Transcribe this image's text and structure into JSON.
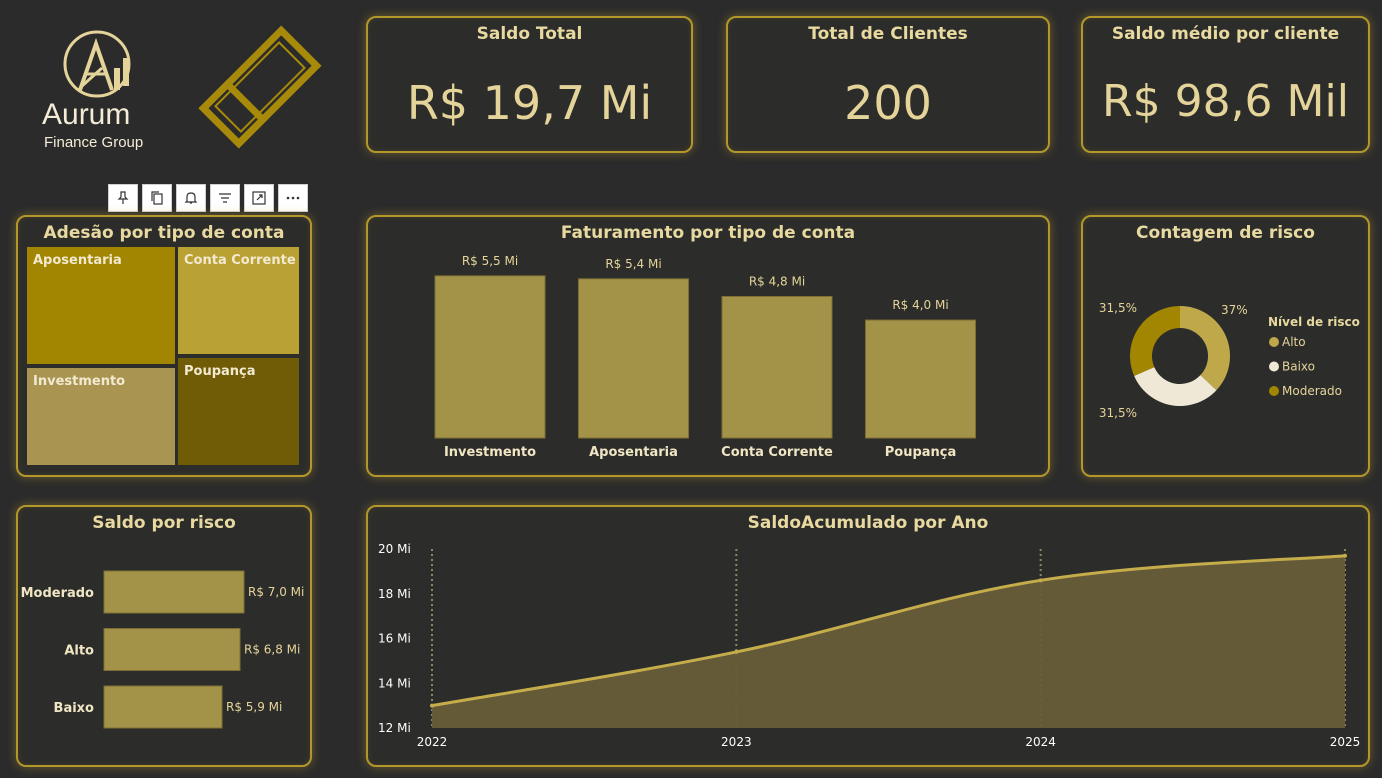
{
  "brand": {
    "name": "Aurum",
    "subtitle": "Finance Group"
  },
  "colors": {
    "background": "#2b2b2b",
    "accent": "#b3972a",
    "text": "#e8d9a0",
    "bar": "#a39348",
    "treemap": [
      "#a28500",
      "#baa133",
      "#a99551",
      "#705c06"
    ],
    "donut": {
      "Alto": "#bfa84a",
      "Baixo": "#efe8d6",
      "Moderado": "#a28500"
    },
    "area_fill": "#675d38",
    "area_line": "#c4ad4a"
  },
  "toolbar": {
    "icons": [
      "pin-icon",
      "copy-icon",
      "bell-icon",
      "filter-icon",
      "expand-icon",
      "more-icon"
    ]
  },
  "kpis": {
    "saldo_total": {
      "title": "Saldo Total",
      "value": "R$ 19,7 Mi"
    },
    "total_clientes": {
      "title": "Total de Clientes",
      "value": "200"
    },
    "saldo_medio": {
      "title": "Saldo médio por cliente",
      "value": "R$ 98,6 Mil"
    }
  },
  "treemap": {
    "title": "Adesão por tipo de conta",
    "items": [
      {
        "label": "Aposentaria"
      },
      {
        "label": "Conta Corrente"
      },
      {
        "label": "Investmento"
      },
      {
        "label": "Poupança"
      }
    ]
  },
  "faturamento": {
    "title": "Faturamento por tipo de conta"
  },
  "risco": {
    "title": "Contagem de risco",
    "legend_title": "Nível de risco"
  },
  "saldo_risco": {
    "title": "Saldo por risco"
  },
  "saldo_ano": {
    "title": "SaldoAcumulado por Ano"
  },
  "chart_data": [
    {
      "id": "faturamento",
      "type": "bar",
      "title": "Faturamento por tipo de conta",
      "categories": [
        "Investmento",
        "Aposentaria",
        "Conta Corrente",
        "Poupança"
      ],
      "values": [
        5.5,
        5.4,
        4.8,
        4.0
      ],
      "labels": [
        "R$ 5,5 Mi",
        "R$ 5,4 Mi",
        "R$ 4,8 Mi",
        "R$ 4,0 Mi"
      ],
      "ylim": [
        0,
        5.8
      ]
    },
    {
      "id": "risco",
      "type": "pie",
      "title": "Contagem de risco",
      "legend_title": "Nível de risco",
      "legend_position": "right",
      "categories": [
        "Alto",
        "Baixo",
        "Moderado"
      ],
      "values": [
        37,
        31.5,
        31.5
      ],
      "labels": [
        "37%",
        "31,5%",
        "31,5%"
      ]
    },
    {
      "id": "saldo_risco",
      "type": "bar",
      "orientation": "horizontal",
      "title": "Saldo por risco",
      "categories": [
        "Moderado",
        "Alto",
        "Baixo"
      ],
      "values": [
        7.0,
        6.8,
        5.9
      ],
      "labels": [
        "R$ 7,0 Mi",
        "R$ 6,8 Mi",
        "R$ 5,9 Mi"
      ],
      "xlim": [
        0,
        7.0
      ]
    },
    {
      "id": "saldo_ano",
      "type": "area",
      "title": "SaldoAcumulado por Ano",
      "x": [
        2022,
        2023,
        2024,
        2025
      ],
      "x_ticks": [
        "2022",
        "2023",
        "2024",
        "2025"
      ],
      "values": [
        13.0,
        15.4,
        18.6,
        19.7
      ],
      "ylim": [
        12,
        20
      ],
      "y_ticks": [
        "12 Mi",
        "14 Mi",
        "16 Mi",
        "18 Mi",
        "20 Mi"
      ],
      "y_tick_values": [
        12,
        14,
        16,
        18,
        20
      ],
      "grid": "vertical dotted"
    }
  ]
}
